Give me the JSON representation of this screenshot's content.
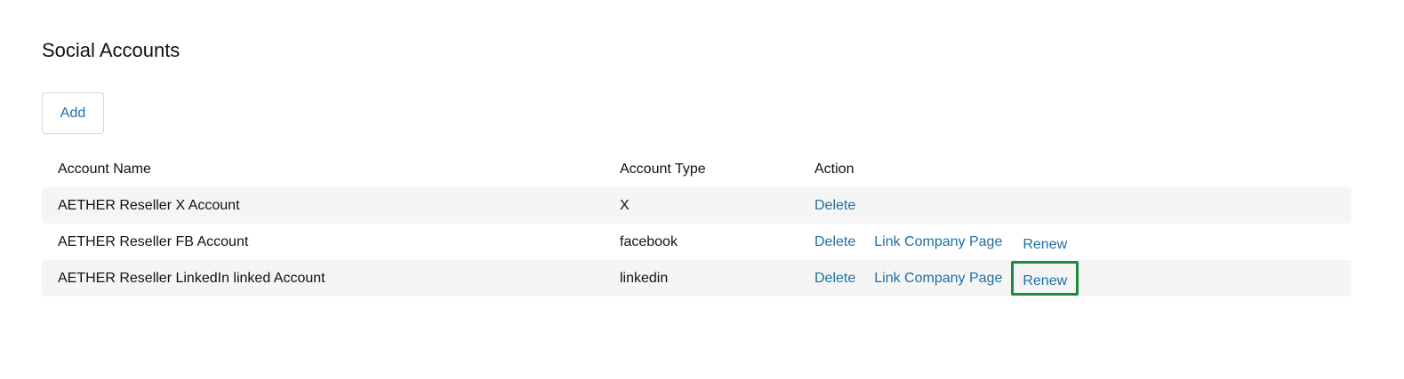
{
  "header": {
    "title": "Social Accounts",
    "add_label": "Add"
  },
  "table": {
    "columns": [
      "Account Name",
      "Account Type",
      "Action"
    ],
    "rows": [
      {
        "name": "AETHER Reseller X Account",
        "type": "X",
        "actions": [
          "Delete"
        ]
      },
      {
        "name": "AETHER Reseller FB Account",
        "type": "facebook",
        "actions": [
          "Delete",
          "Link Company Page",
          "Renew"
        ]
      },
      {
        "name": "AETHER Reseller LinkedIn linked Account",
        "type": "linkedin",
        "actions": [
          "Delete",
          "Link Company Page",
          "Renew"
        ]
      }
    ]
  },
  "colors": {
    "link": "#1f6fa3",
    "focus_outline": "#1e8a3e",
    "row_shade": "#f5f5f5"
  }
}
